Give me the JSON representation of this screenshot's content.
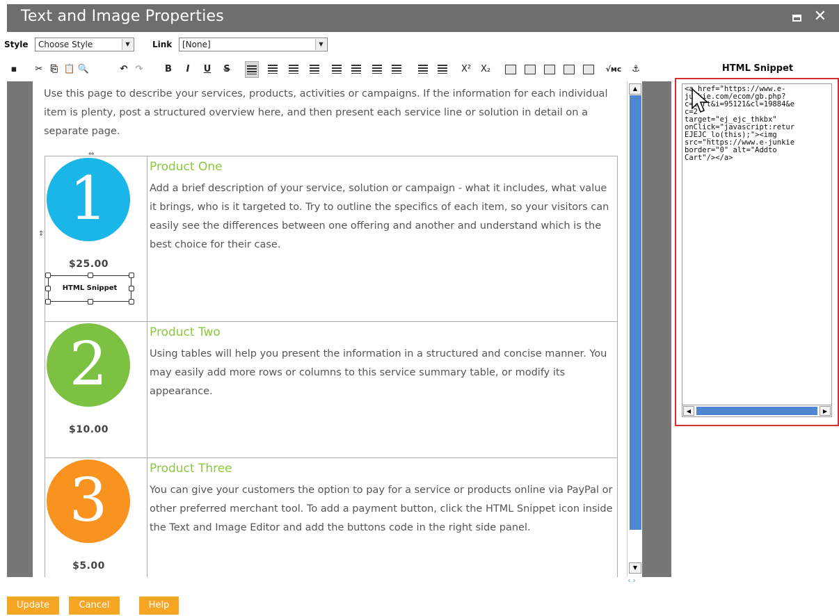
{
  "window": {
    "title": "Text and Image Properties"
  },
  "row1": {
    "style_label": "Style",
    "style_value": "Choose Style",
    "link_label": "Link",
    "link_value": "[None]"
  },
  "toolbar": {
    "bold": "B",
    "italic": "I",
    "underline": "U",
    "strike": "S",
    "superscript": "X²",
    "subscript": "X₂",
    "vmc": "√мс"
  },
  "snippet_panel": {
    "heading": "HTML Snippet",
    "code_lines": [
      "<a href=\"https://www.e-",
      "junkie.com/ecom/gb.php?",
      "c=cart&i=95121&cl=19884&e",
      "c=2\"",
      "target=\"ej_ejc_thkbx\"",
      "onClick=\"javascript:retur",
      "EJEJC_lo(this);\"><img",
      "src=\"https://www.e-junkie",
      "border=\"0\" alt=\"Addto",
      "Cart\"/></a>"
    ]
  },
  "editor": {
    "intro": "Use this page to describe your services, products, activities or campaigns. If the information for each individual item is plenty, post a structured overview here, and then present each service line or solution in detail on a separate page.",
    "snippet_placeholder": "HTML Snippet",
    "products": [
      {
        "number": "1",
        "color": "#1ab6e8",
        "title": "Product One",
        "price": "$25.00",
        "description": "Add a brief description of your service, solution or campaign - what it includes, what value it brings, who is it targeted to. Try to outline the specifics of each item, so your visitors can easily see the differences between one offering and another and understand which is the best choice for their case."
      },
      {
        "number": "2",
        "color": "#7cc142",
        "title": "Product Two",
        "price": "$10.00",
        "description": "Using tables will help you present the information in a structured and concise manner. You may easily add more rows or columns to this service summary table, or modify its appearance."
      },
      {
        "number": "3",
        "color": "#f7931e",
        "title": "Product Three",
        "price": "$5.00",
        "description": "You can give your customers the option to pay for a service or products online via PayPal or other preferred merchant tool. To add a payment button, click the HTML Snippet icon inside the Text and Image Editor and add the buttons code in the right side panel."
      }
    ]
  },
  "footer": {
    "update": "Update",
    "cancel": "Cancel",
    "help": "Help"
  },
  "colors": {
    "accent_orange": "#f5a623",
    "scroll_blue": "#4f86d1",
    "panel_red": "#d32f2f",
    "title_green": "#8dc63f"
  }
}
